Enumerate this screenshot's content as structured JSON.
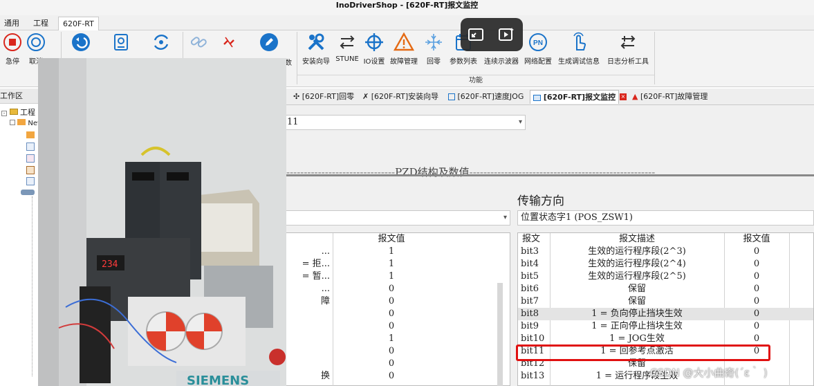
{
  "window": {
    "title": "InoDriverShop - [620F-RT]报文监控"
  },
  "menubar": {
    "items": [
      "通用",
      "工程",
      "620F-RT"
    ]
  },
  "ribbon": {
    "group1": [
      {
        "label": "急停",
        "icon": "emergency-stop-icon"
      },
      {
        "label": "取消",
        "icon": "cancel-circle-icon"
      },
      {
        "label": "",
        "icon": "back-arrow-icon"
      },
      {
        "label": "",
        "icon": "monitor-icon"
      },
      {
        "label": "",
        "icon": "sync-icon"
      }
    ],
    "group2": [
      {
        "label": "",
        "icon": "link-icon"
      },
      {
        "label": "",
        "icon": "unlink-icon"
      },
      {
        "label": "",
        "icon": "edit-pencil-icon"
      },
      {
        "label": "数",
        "icon": ""
      }
    ],
    "group3": [
      {
        "label": "安装向导",
        "icon": "tools-icon"
      },
      {
        "label": "STUNE",
        "icon": "stune-icon"
      },
      {
        "label": "IO设置",
        "icon": "crosshair-icon"
      },
      {
        "label": "故障管理",
        "icon": "warning-icon"
      },
      {
        "label": "回零",
        "icon": "home-return-icon"
      },
      {
        "label": "参数列表",
        "icon": "param-list-icon"
      },
      {
        "label": "连续示波器",
        "icon": "oscilloscope-icon"
      },
      {
        "label": "网络配置",
        "icon": "pn-network-icon"
      },
      {
        "label": "生成调试信息",
        "icon": "debug-info-icon"
      },
      {
        "label": "日志分析工具",
        "icon": "log-analysis-icon"
      }
    ],
    "group3_title": "功能"
  },
  "left_panel": {
    "title": "工作区",
    "tree": [
      {
        "label": "工程"
      },
      {
        "label": "New"
      }
    ]
  },
  "tabs": [
    {
      "label": "[620F-RT]回零"
    },
    {
      "label": "[620F-RT]安装向导"
    },
    {
      "label": "[620F-RT]速度JOG"
    },
    {
      "label": "[620F-RT]报文监控"
    },
    {
      "label": "[620F-RT]故障管理"
    }
  ],
  "content": {
    "telegram_select": "11",
    "pzd_title": "PZD结构及数值",
    "direction_label": "传输方向",
    "left_combo": "",
    "right_combo": "位置状态字1 (POS_ZSW1)",
    "left_table": {
      "value_header": "报文值",
      "rows": [
        {
          "desc": "...",
          "value": "1"
        },
        {
          "desc": "= 拒...",
          "value": "1"
        },
        {
          "desc": "= 暂...",
          "value": "1"
        },
        {
          "desc": "...",
          "value": "0"
        },
        {
          "desc": "障",
          "value": "0"
        },
        {
          "desc": "",
          "value": "0"
        },
        {
          "desc": "",
          "value": "0"
        },
        {
          "desc": "",
          "value": "1"
        },
        {
          "desc": "",
          "value": "0"
        },
        {
          "desc": "",
          "value": "0"
        },
        {
          "desc": "换",
          "value": "0"
        }
      ]
    },
    "right_table": {
      "headers": [
        "报文",
        "报文描述",
        "报文值"
      ],
      "rows": [
        {
          "bit": "bit3",
          "desc": "生效的运行程序段(2^3)",
          "value": "0"
        },
        {
          "bit": "bit4",
          "desc": "生效的运行程序段(2^4)",
          "value": "0"
        },
        {
          "bit": "bit5",
          "desc": "生效的运行程序段(2^5)",
          "value": "0"
        },
        {
          "bit": "bit6",
          "desc": "保留",
          "value": "0"
        },
        {
          "bit": "bit7",
          "desc": "保留",
          "value": "0"
        },
        {
          "bit": "bit8",
          "desc": "1 = 负向停止挡块生效",
          "value": "0"
        },
        {
          "bit": "bit9",
          "desc": "1 = 正向停止挡块生效",
          "value": "0"
        },
        {
          "bit": "bit10",
          "desc": "1 = JOG生效",
          "value": "0"
        },
        {
          "bit": "bit11",
          "desc": "1 = 回参考点激活",
          "value": "0"
        },
        {
          "bit": "bit12",
          "desc": "保留",
          "value": ""
        },
        {
          "bit": "bit13",
          "desc": "1 = 运行程序段生效",
          "value": ""
        }
      ]
    }
  },
  "watermark": "CSDN @大小曲奇(´ε｀ )",
  "colors": {
    "accent_blue": "#1a73c9",
    "warn_red": "#d9261c",
    "highlight_red": "#e01010"
  }
}
